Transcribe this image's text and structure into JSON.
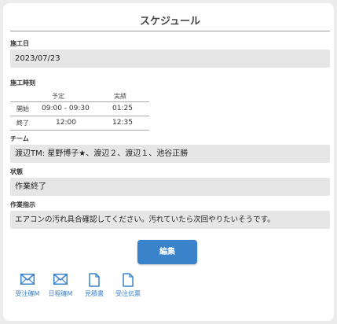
{
  "header": {
    "title": "スケジュール"
  },
  "work_date": {
    "label": "施工日",
    "value": "2023/07/23"
  },
  "work_time": {
    "label": "施工時刻",
    "col_planned": "予定",
    "col_actual": "実績",
    "rows": [
      {
        "label": "開始",
        "planned": "09:00 - 09:30",
        "actual": "01:25"
      },
      {
        "label": "終了",
        "planned": "12:00",
        "actual": "12:35"
      }
    ]
  },
  "team": {
    "label": "チーム",
    "value": "渡辺TM: 星野博子★、渡辺２、渡辺１、池谷正勝"
  },
  "status": {
    "label": "状態",
    "value": "作業終了"
  },
  "instructions": {
    "label": "作業指示",
    "value": "エアコンの汚れ具合確認してください。汚れていたら次回やりたいそうです。"
  },
  "actions": {
    "edit_label": "編集"
  },
  "links": [
    {
      "label": "受注確M",
      "icon": "mail-icon"
    },
    {
      "label": "日程確M",
      "icon": "mail-icon"
    },
    {
      "label": "見積書",
      "icon": "document-icon"
    },
    {
      "label": "受注伝票",
      "icon": "document-icon"
    }
  ],
  "colors": {
    "accent": "#3a82c9",
    "field_bg": "#e6e6e6"
  }
}
